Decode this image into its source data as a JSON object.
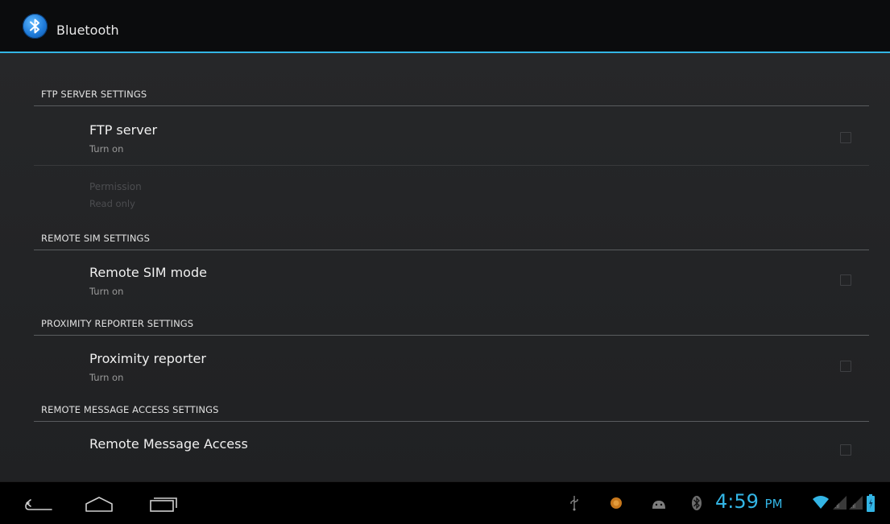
{
  "actionbar": {
    "icon": "bluetooth-icon",
    "title": "Bluetooth"
  },
  "sections": [
    {
      "header": "FTP SERVER SETTINGS",
      "items": [
        {
          "title": "FTP server",
          "summary": "Turn on",
          "checked": false,
          "enabled": true
        },
        {
          "title": "Permission",
          "summary": "Read only",
          "enabled": false
        }
      ]
    },
    {
      "header": "REMOTE SIM SETTINGS",
      "items": [
        {
          "title": "Remote SIM mode",
          "summary": "Turn on",
          "checked": false,
          "enabled": true
        }
      ]
    },
    {
      "header": "PROXIMITY REPORTER SETTINGS",
      "items": [
        {
          "title": "Proximity reporter",
          "summary": "Turn on",
          "checked": false,
          "enabled": true
        }
      ]
    },
    {
      "header": "REMOTE MESSAGE ACCESS SETTINGS",
      "items": [
        {
          "title": "Remote Message Access",
          "checked": false,
          "enabled": true
        }
      ]
    }
  ],
  "navbar": {
    "buttons": [
      "back-icon",
      "home-icon",
      "recent-apps-icon"
    ],
    "status_icons": [
      "usb-icon",
      "notification-app-icon",
      "android-debug-icon",
      "bluetooth-status-icon",
      "wifi-icon",
      "signal-icon",
      "battery-icon"
    ],
    "time": "4:59",
    "ampm": "PM",
    "accent": "#33b5e5"
  }
}
